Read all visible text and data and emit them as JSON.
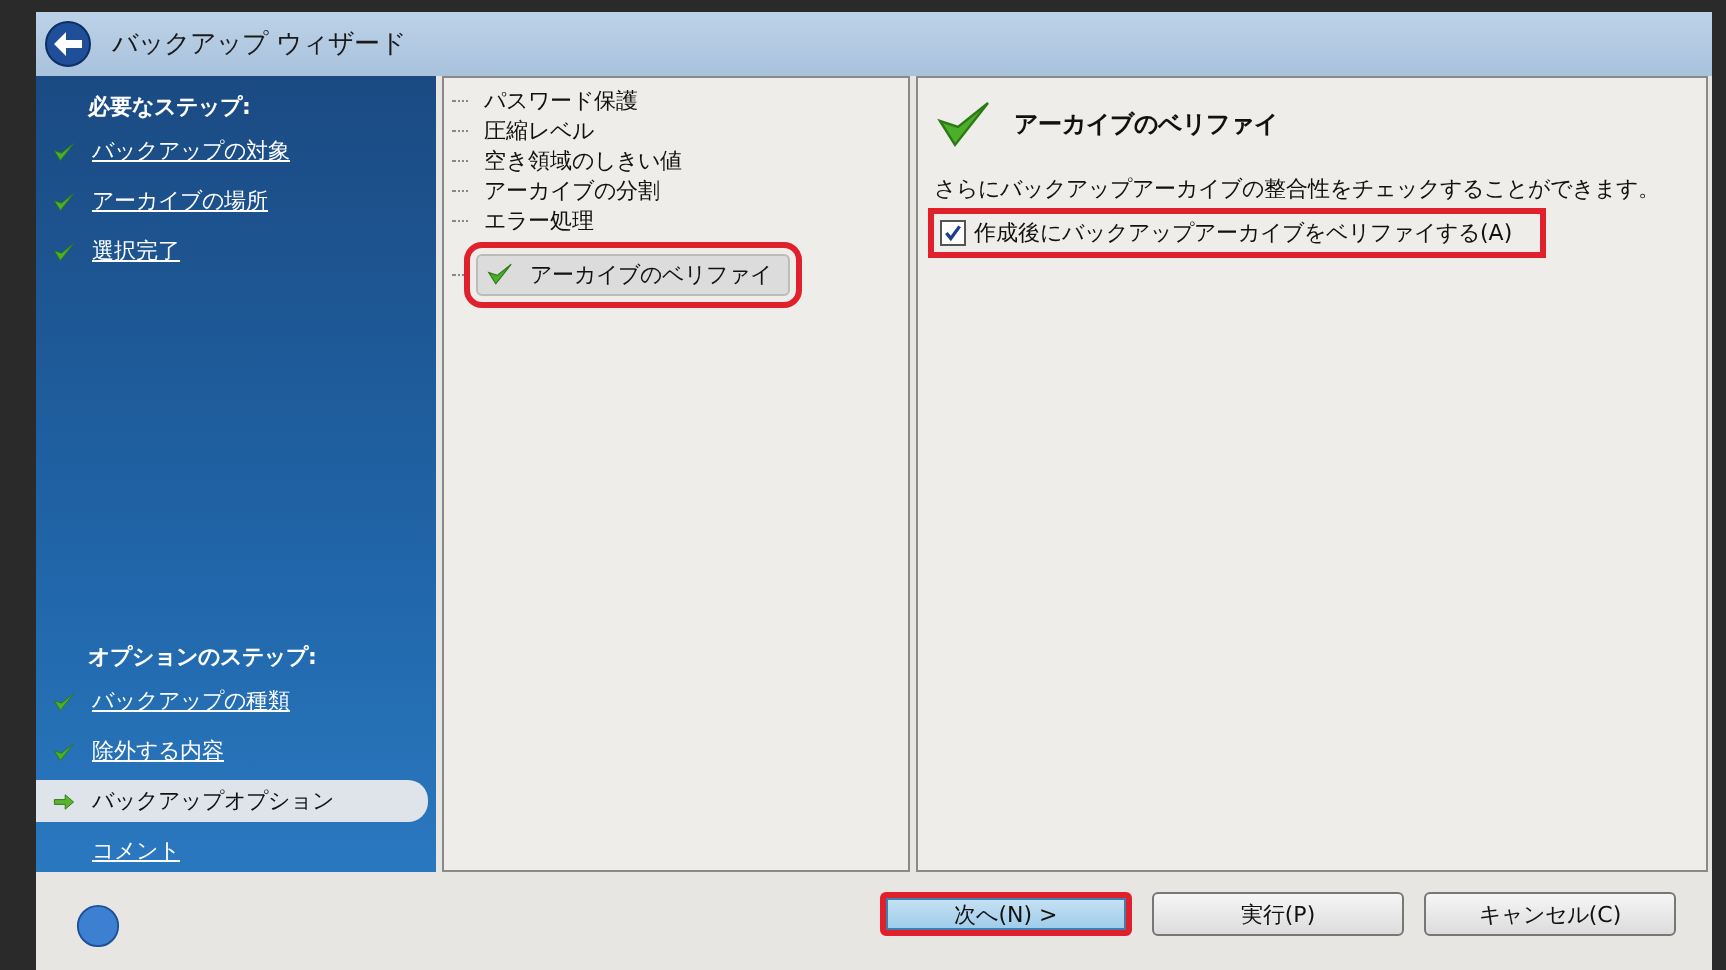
{
  "window": {
    "title": "バックアップ ウィザード"
  },
  "sidebar": {
    "required_heading": "必要なステップ:",
    "required_steps": [
      {
        "label": "バックアップの対象",
        "done": true,
        "selected": false
      },
      {
        "label": "アーカイブの場所",
        "done": true,
        "selected": false
      },
      {
        "label": "選択完了",
        "done": true,
        "selected": false
      }
    ],
    "optional_heading": "オプションのステップ:",
    "optional_steps": [
      {
        "label": "バックアップの種類",
        "done": true,
        "selected": false
      },
      {
        "label": "除外する内容",
        "done": true,
        "selected": false
      },
      {
        "label": "バックアップオプション",
        "done": false,
        "selected": true
      },
      {
        "label": "コメント",
        "done": false,
        "selected": false
      }
    ]
  },
  "options_tree": [
    {
      "label": "パスワード保護",
      "selected": false,
      "highlighted": false
    },
    {
      "label": "圧縮レベル",
      "selected": false,
      "highlighted": false
    },
    {
      "label": "空き領域のしきい値",
      "selected": false,
      "highlighted": false
    },
    {
      "label": "アーカイブの分割",
      "selected": false,
      "highlighted": false
    },
    {
      "label": "エラー処理",
      "selected": false,
      "highlighted": false
    },
    {
      "label": "アーカイブのベリファイ",
      "selected": true,
      "highlighted": true
    }
  ],
  "panel": {
    "title": "アーカイブのベリファイ",
    "description": "さらにバックアップアーカイブの整合性をチェックすることができます。",
    "checkbox": {
      "label": "作成後にバックアップアーカイブをベリファイする(A)",
      "checked": true,
      "highlighted": true
    }
  },
  "buttons": [
    {
      "label": "次へ(N) >",
      "default": true,
      "highlighted": true
    },
    {
      "label": "実行(P)",
      "default": false,
      "highlighted": false
    },
    {
      "label": "キャンセル(C)",
      "default": false,
      "highlighted": false
    }
  ]
}
